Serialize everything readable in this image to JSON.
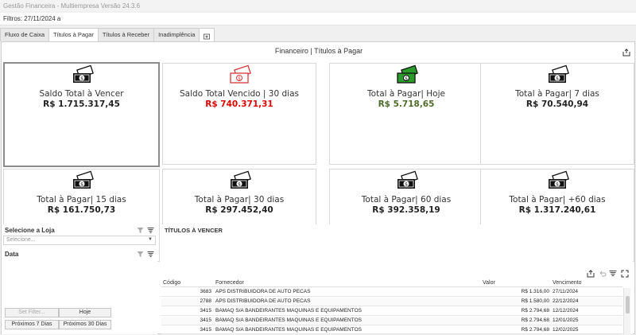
{
  "window": {
    "title": "Gestão Financeira - Multiempresa Versão 24.3.6"
  },
  "filter": {
    "text": "Filtros: 27/11/2024 a"
  },
  "tabs": [
    {
      "label": "Fluxo de Caixa"
    },
    {
      "label": "Títulos à Pagar",
      "active": true
    },
    {
      "label": "Títulos à Receber"
    },
    {
      "label": "Inadimplência"
    }
  ],
  "dashboard": {
    "title": "Financeiro | Títulos à Pagar",
    "cards": [
      {
        "label": "Saldo Total à Vencer",
        "value": "R$ 1.715.317,45",
        "color": "#222222",
        "icon_color": "#111111"
      },
      {
        "label": "Saldo Total Vencido | 30 dias",
        "value": "R$ 740.371,31",
        "color": "#e00000",
        "icon_color": "#d43a3a"
      },
      {
        "label": "Total à Pagar| Hoje",
        "value": "R$ 5.718,65",
        "color": "#4e6b2a",
        "icon_color": "#2a9a2a"
      },
      {
        "label": "Total à Pagar| 7 dias",
        "value": "R$ 70.540,94",
        "color": "#222222",
        "icon_color": "#111111"
      },
      {
        "label": "Total à Pagar| 15 dias",
        "value": "R$ 161.750,73",
        "color": "#222222",
        "icon_color": "#111111"
      },
      {
        "label": "Total à Pagar| 30 dias",
        "value": "R$ 297.452,40",
        "color": "#222222",
        "icon_color": "#111111"
      },
      {
        "label": "Total à Pagar| 60 dias",
        "value": "R$ 392.358,19",
        "color": "#222222",
        "icon_color": "#111111"
      },
      {
        "label": "Total à Pagar| +60 dias",
        "value": "R$ 1.317.240,61",
        "color": "#222222",
        "icon_color": "#111111"
      }
    ]
  },
  "loja": {
    "title": "Selecione a Loja",
    "placeholder": "Selecione..."
  },
  "data_panel": {
    "title": "Data",
    "buttons": {
      "set_filter": "Set Filter...",
      "hoje": "Hoje",
      "prox7": "Próximos 7 Dias",
      "prox30": "Próximos 30 Dias"
    }
  },
  "titulos": {
    "title": "TÍTULOS À VENCER",
    "columns": {
      "codigo": "Código",
      "fornecedor": "Fornecedor",
      "valor": "Valor",
      "vencimento": "Vencimento"
    },
    "rows": [
      {
        "codigo": "3683",
        "fornecedor": "APS DISTRIBUIDORA DE AUTO PECAS",
        "valor": "R$ 1.316,00",
        "vencimento": "27/11/2024"
      },
      {
        "codigo": "2788",
        "fornecedor": "APS DISTRIBUIDORA DE AUTO PECAS",
        "valor": "R$ 1.580,00",
        "vencimento": "22/12/2024"
      },
      {
        "codigo": "3415",
        "fornecedor": "BAMAQ S/A BANDEIRANTES MAQUINAS E EQUIPAMENTOS",
        "valor": "R$ 2.794,68",
        "vencimento": "12/12/2024"
      },
      {
        "codigo": "3415",
        "fornecedor": "BAMAQ S/A BANDEIRANTES MAQUINAS E EQUIPAMENTOS",
        "valor": "R$ 2.794,68",
        "vencimento": "12/01/2025"
      },
      {
        "codigo": "3415",
        "fornecedor": "BAMAQ S/A BANDEIRANTES MAQUINAS E EQUIPAMENTOS",
        "valor": "R$ 2.794,68",
        "vencimento": "12/02/2025"
      }
    ]
  },
  "icons": {
    "share": "share-icon",
    "money": "money-bill-icon",
    "filter": "filter-clear-icon",
    "filter_edit": "filter-edit-icon",
    "undo": "undo-icon",
    "expand": "expand-icon"
  }
}
